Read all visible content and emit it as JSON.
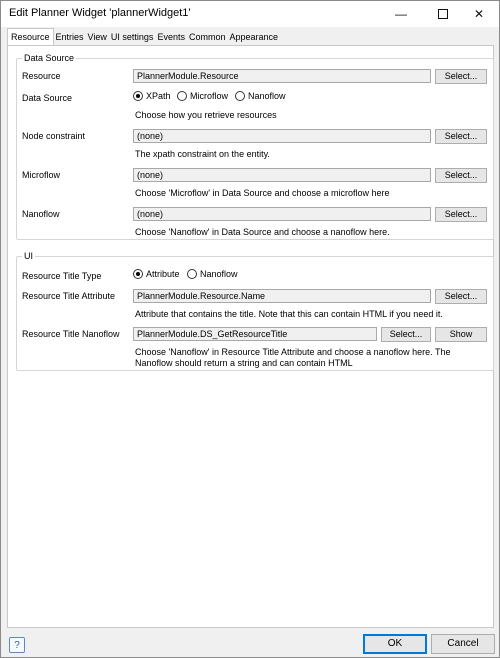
{
  "window": {
    "title": "Edit Planner Widget 'plannerWidget1'",
    "minimize": "—",
    "close": "✕"
  },
  "tabs": [
    "Resource",
    "Entries",
    "View",
    "UI settings",
    "Events",
    "Common",
    "Appearance"
  ],
  "data_source_group": {
    "title": "Data Source",
    "resource": {
      "label": "Resource",
      "value": "PlannerModule.Resource",
      "button": "Select..."
    },
    "data_source": {
      "label": "Data Source",
      "options": [
        "XPath",
        "Microflow",
        "Nanoflow"
      ],
      "selected": "XPath",
      "help": "Choose how you retrieve resources"
    },
    "node_constraint": {
      "label": "Node constraint",
      "value": "(none)",
      "button": "Select...",
      "help": "The xpath constraint on the entity."
    },
    "microflow": {
      "label": "Microflow",
      "value": "(none)",
      "button": "Select...",
      "help": "Choose 'Microflow' in Data Source and choose a microflow here"
    },
    "nanoflow": {
      "label": "Nanoflow",
      "value": "(none)",
      "button": "Select...",
      "help": "Choose 'Nanoflow' in Data Source and choose a nanoflow here."
    }
  },
  "ui_group": {
    "title": "UI",
    "title_type": {
      "label": "Resource Title Type",
      "options": [
        "Attribute",
        "Nanoflow"
      ],
      "selected": "Attribute"
    },
    "title_attribute": {
      "label": "Resource Title Attribute",
      "value": "PlannerModule.Resource.Name",
      "button": "Select...",
      "help": "Attribute that contains the title. Note that this can contain HTML if you need it."
    },
    "title_nanoflow": {
      "label": "Resource Title Nanoflow",
      "value": "PlannerModule.DS_GetResourceTitle",
      "button": "Select...",
      "show_button": "Show",
      "help_line1": "Choose 'Nanoflow' in Resource Title Attribute and choose a nanoflow here. The",
      "help_line2": "Nanoflow should return a string and can contain HTML"
    }
  },
  "footer": {
    "help_icon": "?",
    "ok": "OK",
    "cancel": "Cancel"
  }
}
